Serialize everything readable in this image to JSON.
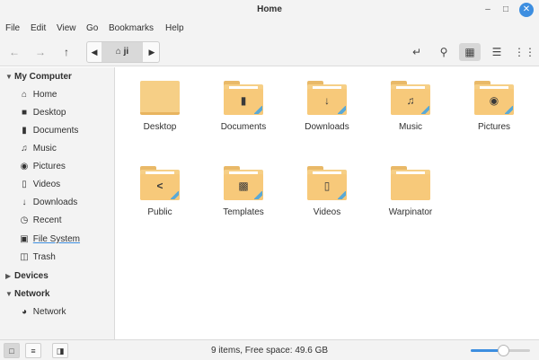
{
  "window": {
    "title": "Home"
  },
  "menu": [
    "File",
    "Edit",
    "View",
    "Go",
    "Bookmarks",
    "Help"
  ],
  "toolbar": {
    "path_home_label": "ji",
    "icons": [
      "back-arrow-icon",
      "forward-arrow-icon",
      "up-arrow-icon",
      "terminal-icon",
      "search-icon",
      "grid-view-icon",
      "list-view-icon",
      "compact-view-icon"
    ]
  },
  "sidebar": {
    "sections": [
      {
        "title": "My Computer",
        "items": [
          {
            "label": "Home",
            "icon": "home-icon"
          },
          {
            "label": "Desktop",
            "icon": "desktop-icon"
          },
          {
            "label": "Documents",
            "icon": "documents-icon"
          },
          {
            "label": "Music",
            "icon": "music-icon"
          },
          {
            "label": "Pictures",
            "icon": "camera-icon"
          },
          {
            "label": "Videos",
            "icon": "film-icon"
          },
          {
            "label": "Downloads",
            "icon": "download-icon"
          },
          {
            "label": "Recent",
            "icon": "clock-icon"
          },
          {
            "label": "File System",
            "icon": "drive-icon"
          },
          {
            "label": "Trash",
            "icon": "trash-icon"
          }
        ]
      },
      {
        "title": "Devices",
        "items": []
      },
      {
        "title": "Network",
        "items": [
          {
            "label": "Network",
            "icon": "network-icon"
          }
        ]
      }
    ]
  },
  "files": [
    {
      "name": "Desktop",
      "emblem": ""
    },
    {
      "name": "Documents",
      "emblem": "document"
    },
    {
      "name": "Downloads",
      "emblem": "download"
    },
    {
      "name": "Music",
      "emblem": "music"
    },
    {
      "name": "Pictures",
      "emblem": "camera"
    },
    {
      "name": "Public",
      "emblem": "share"
    },
    {
      "name": "Templates",
      "emblem": "template"
    },
    {
      "name": "Videos",
      "emblem": "film"
    },
    {
      "name": "Warpinator",
      "emblem": ""
    }
  ],
  "status": {
    "text": "9 items, Free space: 49.6 GB",
    "zoom_fraction": 0.55
  },
  "colors": {
    "accent": "#3d8ee0",
    "folder": "#f6cf86",
    "folder_stripe": "#5aa9d6",
    "chrome": "#f3f3f3"
  }
}
